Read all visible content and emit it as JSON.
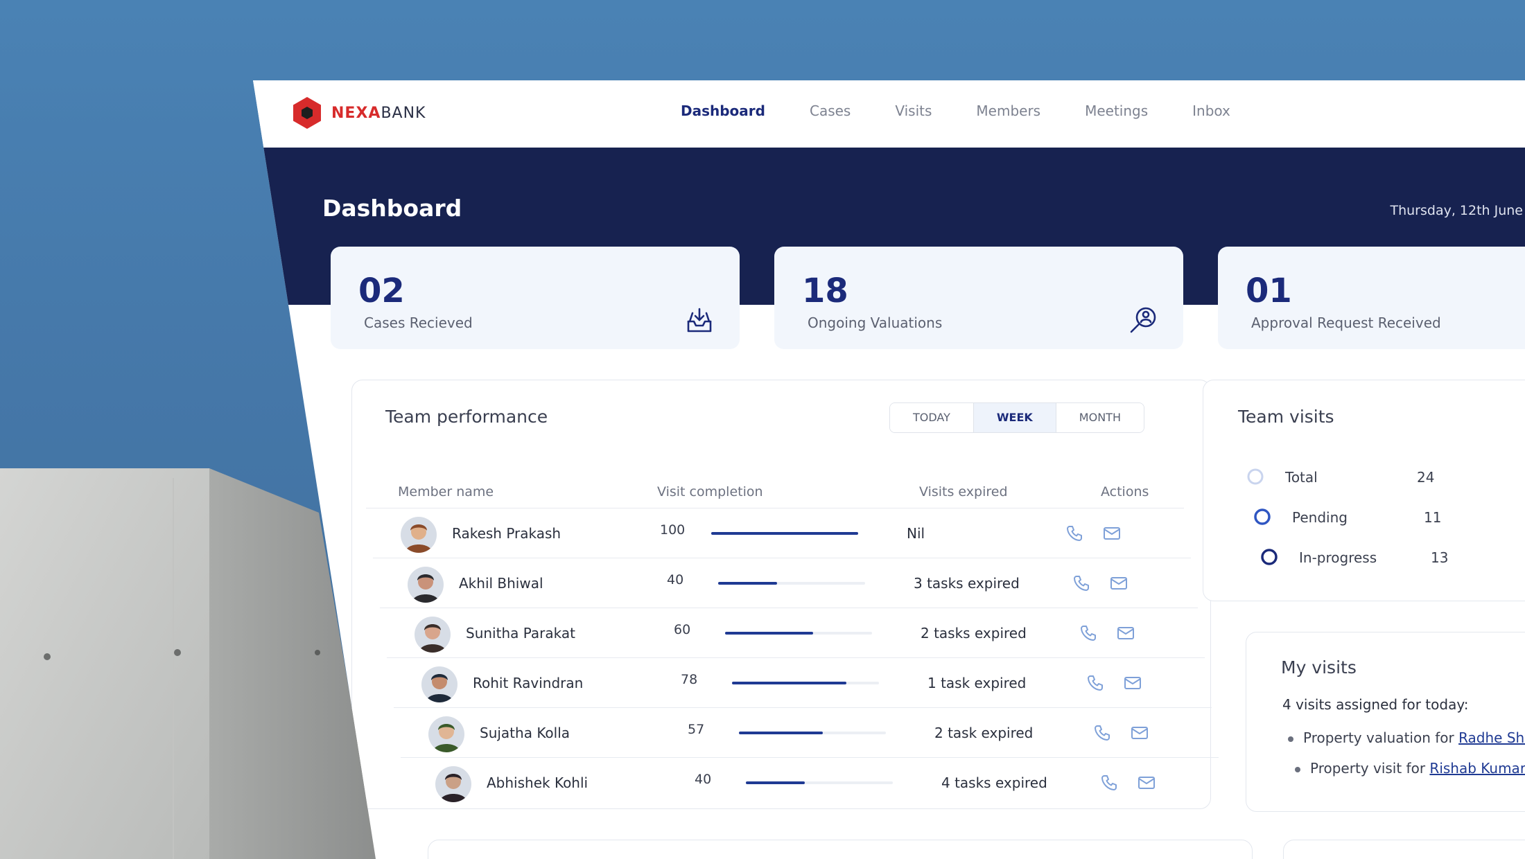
{
  "brand": {
    "name_part1": "NEXA",
    "name_part2": "BANK",
    "primary_color": "#172250",
    "accent_color": "#d72b2b"
  },
  "nav": {
    "items": [
      {
        "label": "Dashboard",
        "active": true
      },
      {
        "label": "Cases"
      },
      {
        "label": "Visits"
      },
      {
        "label": "Members"
      },
      {
        "label": "Meetings"
      },
      {
        "label": "Inbox"
      }
    ]
  },
  "header": {
    "title": "Dashboard",
    "date": "Thursday, 12th June"
  },
  "stats": [
    {
      "value": "02",
      "label": "Cases Recieved",
      "icon": "inbox-download-icon"
    },
    {
      "value": "18",
      "label": "Ongoing Valuations",
      "icon": "user-search-icon"
    },
    {
      "value": "01",
      "label": "Approval Request Received"
    }
  ],
  "team_performance": {
    "title": "Team performance",
    "periods": [
      "TODAY",
      "WEEK",
      "MONTH"
    ],
    "active_period": "WEEK",
    "columns": [
      "Member name",
      "Visit completion",
      "Visits expired",
      "Actions"
    ],
    "rows": [
      {
        "name": "Rakesh Prakash",
        "completion": 100,
        "completion_text": "100",
        "expired": "Nil"
      },
      {
        "name": "Akhil Bhiwal",
        "completion": 40,
        "completion_text": "40",
        "expired": "3 tasks expired"
      },
      {
        "name": "Sunitha Parakat",
        "completion": 60,
        "completion_text": "60",
        "expired": "2 tasks expired"
      },
      {
        "name": "Rohit Ravindran",
        "completion": 78,
        "completion_text": "78",
        "expired": "1 task expired"
      },
      {
        "name": "Sujatha Kolla",
        "completion": 57,
        "completion_text": "57",
        "expired": "2 task expired"
      },
      {
        "name": "Abhishek Kohli",
        "completion": 40,
        "completion_text": "40",
        "expired": "4 tasks expired"
      }
    ]
  },
  "team_visits": {
    "title": "Team visits",
    "items": [
      {
        "label": "Total",
        "value": "24"
      },
      {
        "label": "Pending",
        "value": "11"
      },
      {
        "label": "In-progress",
        "value": "13"
      }
    ]
  },
  "my_visits": {
    "title": "My visits",
    "subtitle": "4 visits assigned for today:",
    "items": [
      {
        "text": "Property valuation for ",
        "link": "Radhe Shya"
      },
      {
        "text": "Property visit for ",
        "link": "Rishab Kumar D"
      }
    ]
  }
}
